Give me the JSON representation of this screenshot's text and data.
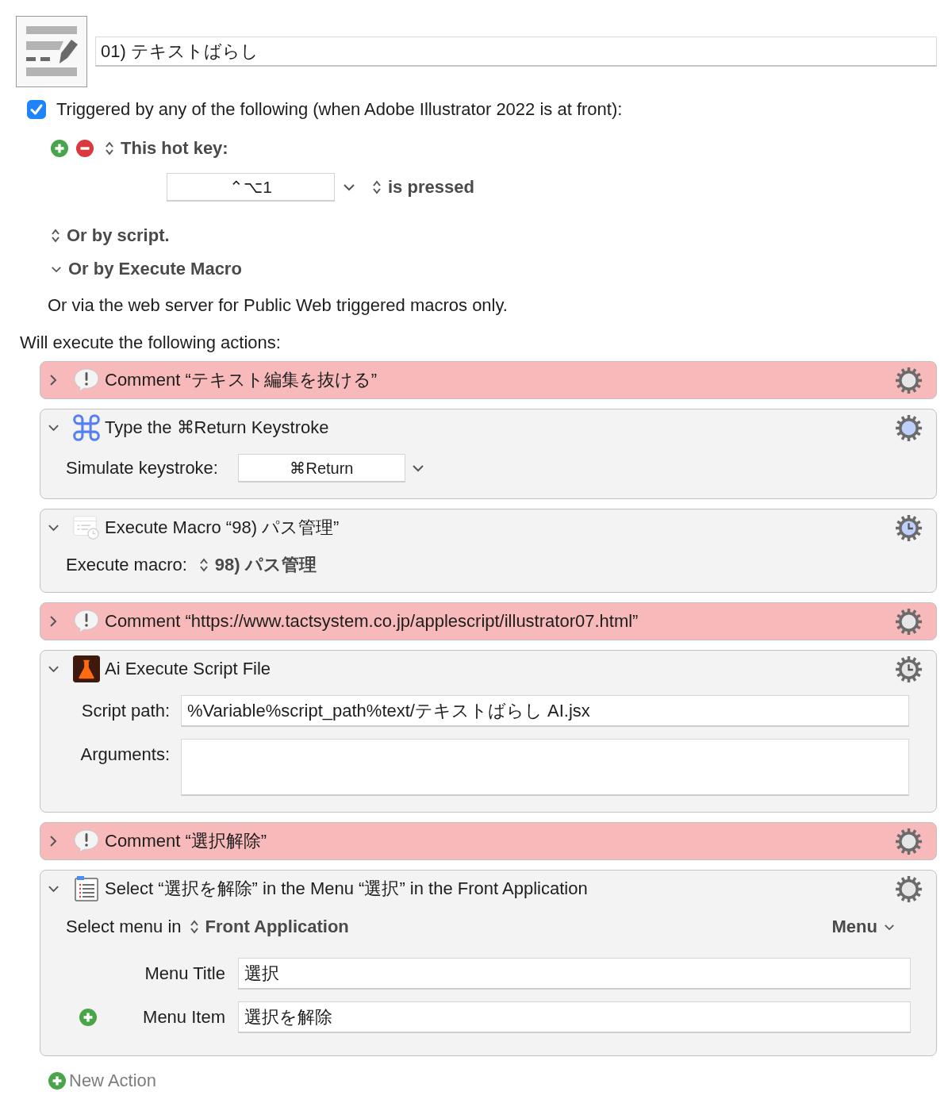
{
  "macro": {
    "name": "01) テキストばらし"
  },
  "trigger": {
    "checked": true,
    "label": "Triggered by any of the following (when Adobe Illustrator 2022 is at front):"
  },
  "hot_key": {
    "trigger_type": "This hot key:",
    "keys": "⌃⌥1",
    "condition": "is pressed"
  },
  "script_trigger": {
    "label": "Or by script."
  },
  "execute_macro_trigger": {
    "label": "Or by Execute Macro",
    "expanded": true
  },
  "web_server_note": "Or via the web server for Public Web triggered macros only.",
  "actions_heading": "Will execute the following actions:",
  "actions": [
    {
      "kind": "comment",
      "expanded": false,
      "title": "Comment “テキスト編集を抜ける”",
      "gear": {
        "color": "#e6e6e6",
        "clock": false
      }
    },
    {
      "kind": "keystroke",
      "expanded": true,
      "title": "Type the ⌘Return Keystroke",
      "gear": {
        "color": "#bdd0fb",
        "clock": false
      },
      "rows": [
        {
          "kind": "keystroke",
          "label": "Simulate keystroke:",
          "value": "⌘Return"
        }
      ]
    },
    {
      "kind": "execute_macro",
      "expanded": true,
      "title": "Execute Macro “98) パス管理”",
      "gear": {
        "color": "#bdd0fb",
        "clock": true
      },
      "rows": [
        {
          "kind": "popup",
          "label": "Execute macro:",
          "value": "98) パス管理"
        }
      ]
    },
    {
      "kind": "comment",
      "expanded": false,
      "title": "Comment “https://www.tactsystem.co.jp/applescript/illustrator07.html”",
      "gear": {
        "color": "#e6e6e6",
        "clock": false
      }
    },
    {
      "kind": "script_file",
      "expanded": true,
      "title": "Ai Execute Script File",
      "gear": {
        "color": "#e6e6e6",
        "clock": true
      },
      "rows": [
        {
          "kind": "text",
          "label": "Script path:",
          "value": "%Variable%script_path%text/テキストばらし AI.jsx"
        },
        {
          "kind": "textarea",
          "label": "Arguments:"
        }
      ]
    },
    {
      "kind": "comment",
      "expanded": false,
      "title": "Comment “選択解除”",
      "gear": {
        "color": "#e6e6e6",
        "clock": false
      }
    },
    {
      "kind": "select_menu",
      "expanded": true,
      "title": "Select “選択を解除” in the Menu “選択” in the Front Application",
      "gear": {
        "color": "#e6e6e6",
        "clock": false
      },
      "rows": [
        {
          "kind": "menu_target",
          "label": "Select menu in",
          "target": "Front Application",
          "menu": "Menu"
        },
        {
          "kind": "menu_field",
          "label": "Menu Title",
          "value": "選択",
          "add_button": false
        },
        {
          "kind": "menu_field",
          "label": "Menu Item",
          "value": "選択を解除",
          "add_button": true
        }
      ]
    }
  ],
  "new_action": {
    "label": "New Action"
  }
}
